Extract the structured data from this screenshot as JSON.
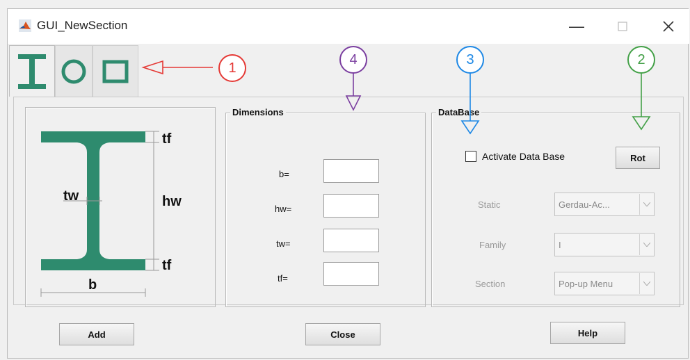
{
  "window": {
    "title": "GUI_NewSection"
  },
  "tabs": [
    {
      "icon": "i-beam-icon"
    },
    {
      "icon": "circle-section-icon"
    },
    {
      "icon": "rectangle-section-icon"
    }
  ],
  "section_image": {
    "tf_top": "tf",
    "hw": "hw",
    "tw": "tw",
    "tf_bottom": "tf",
    "b": "b"
  },
  "dimensions": {
    "title": "Dimensions",
    "fields": [
      {
        "label": "b=",
        "value": ""
      },
      {
        "label": "hw=",
        "value": ""
      },
      {
        "label": "tw=",
        "value": ""
      },
      {
        "label": "tf=",
        "value": ""
      }
    ]
  },
  "database": {
    "title": "DataBase",
    "activate_label": "Activate Data Base",
    "activate_checked": false,
    "rot_label": "Rot",
    "static_label": "Static",
    "static_value": "Gerdau-Ac...",
    "family_label": "Family",
    "family_value": "I",
    "section_label": "Section",
    "section_value": "Pop-up Menu"
  },
  "buttons": {
    "add": "Add",
    "close": "Close",
    "help": "Help"
  },
  "annotations": [
    {
      "number": "1",
      "color": "#e53935"
    },
    {
      "number": "2",
      "color": "#43a047"
    },
    {
      "number": "3",
      "color": "#1e88e5"
    },
    {
      "number": "4",
      "color": "#7b3fa0"
    }
  ],
  "colors": {
    "section_fill": "#2e8b6e"
  }
}
